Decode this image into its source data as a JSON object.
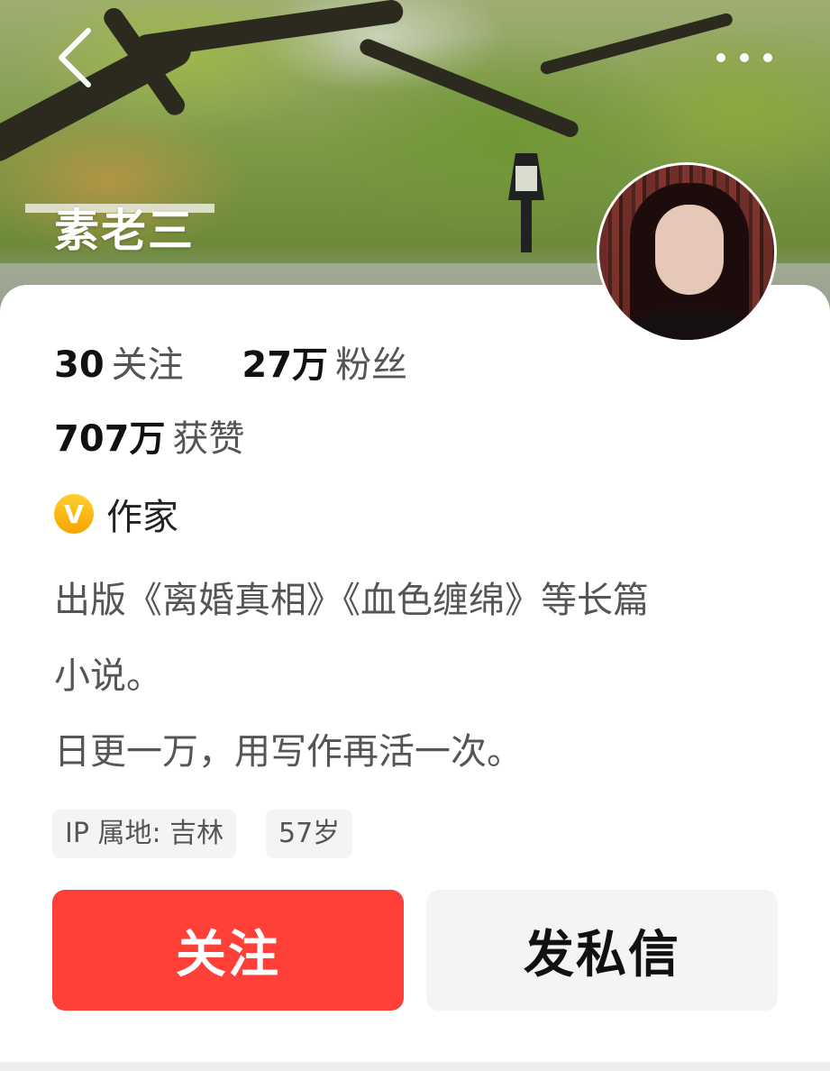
{
  "header": {
    "back_icon": "chevron-left-icon",
    "more_icon": "more-dots-icon",
    "cover_name": "素老三"
  },
  "profile": {
    "avatar_icon": "avatar",
    "stats": {
      "following_count": "30",
      "following_label": "关注",
      "followers_count": "27万",
      "followers_label": "粉丝",
      "likes_count": "707万",
      "likes_label": "获赞"
    },
    "verification": {
      "badge_letter": "V",
      "badge_color": "#f8b500",
      "title": "作家"
    },
    "bio_lines": [
      "出版《离婚真相》《血色缠绵》等长篇",
      "小说。",
      "日更一万，用写作再活一次。"
    ],
    "tags": [
      "IP 属地: 吉林",
      "57岁"
    ]
  },
  "actions": {
    "follow_label": "关注",
    "follow_color": "#fe4038",
    "message_label": "发私信"
  }
}
